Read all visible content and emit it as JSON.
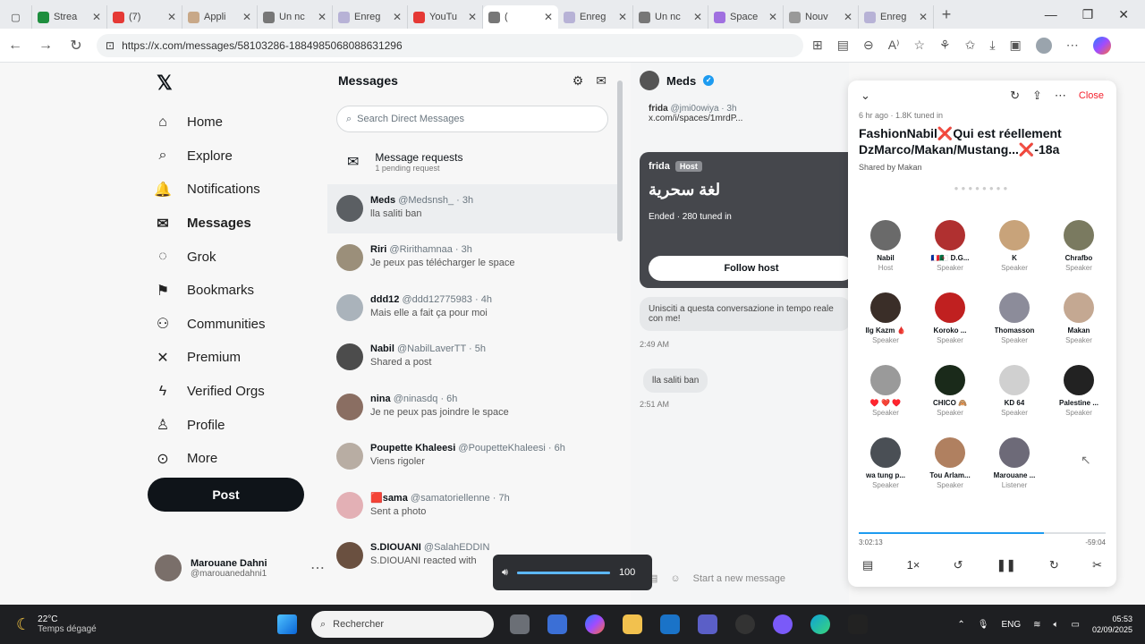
{
  "browser": {
    "tabs": [
      {
        "label": "Strea",
        "color": "#1e8e3e"
      },
      {
        "label": "(7)",
        "color": "#e53935"
      },
      {
        "label": "Appli",
        "color": "#c8a888"
      },
      {
        "label": "Un nc",
        "color": "#777777"
      },
      {
        "label": "Enreg",
        "color": "#b7b2d6"
      },
      {
        "label": "YouTu",
        "color": "#e53935"
      },
      {
        "label": "(",
        "color": "#777777"
      },
      {
        "label": "Enreg",
        "color": "#b7b2d6"
      },
      {
        "label": "Un nc",
        "color": "#777777"
      },
      {
        "label": "Space",
        "color": "#a070e0"
      },
      {
        "label": "Nouv",
        "color": "#999999"
      },
      {
        "label": "Enreg",
        "color": "#b7b2d6"
      }
    ],
    "active_tab_index": 6,
    "url": "https://x.com/messages/58103286-1884985068088631296"
  },
  "sidebar": {
    "items": [
      {
        "label": "Home",
        "icon": "⌂"
      },
      {
        "label": "Explore",
        "icon": "⌕"
      },
      {
        "label": "Notifications",
        "icon": "🔔"
      },
      {
        "label": "Messages",
        "icon": "✉"
      },
      {
        "label": "Grok",
        "icon": "◌"
      },
      {
        "label": "Bookmarks",
        "icon": "⚑"
      },
      {
        "label": "Communities",
        "icon": "⚇"
      },
      {
        "label": "Premium",
        "icon": "✕"
      },
      {
        "label": "Verified Orgs",
        "icon": "ϟ"
      },
      {
        "label": "Profile",
        "icon": "♙"
      },
      {
        "label": "More",
        "icon": "⊙"
      }
    ],
    "post_label": "Post",
    "user_name": "Marouane Dahni",
    "user_handle": "@marouanedahni1"
  },
  "messages": {
    "title": "Messages",
    "search_placeholder": "Search Direct Messages",
    "requests_title": "Message requests",
    "requests_sub": "1 pending request",
    "conversations": [
      {
        "name": "Meds",
        "meta": "@Medsnsh_ · 3h",
        "preview": "lla saliti ban",
        "color": "#5b5f63"
      },
      {
        "name": "Riri",
        "meta": "@Ririthamnaa · 3h",
        "preview": "Je peux pas télécharger le space",
        "color": "#9b8f7a"
      },
      {
        "name": "ddd12",
        "meta": "@ddd12775983 · 4h",
        "preview": "Mais elle a fait ça pour moi",
        "color": "#aab3bb"
      },
      {
        "name": "Nabil",
        "meta": "@NabilLaverTT · 5h",
        "preview": "Shared a post",
        "color": "#4c4c4c"
      },
      {
        "name": "nina",
        "meta": "@ninasdq · 6h",
        "preview": "Je ne peux pas joindre le space",
        "color": "#8a6e62"
      },
      {
        "name": "Poupette Khaleesi",
        "meta": "@PoupetteKhaleesi · 6h",
        "preview": "Viens rigoler",
        "color": "#b8ada3"
      },
      {
        "name": "🟥sama",
        "meta": "@samatoriellenne · 7h",
        "preview": "Sent a photo",
        "color": "#e3b0b5"
      },
      {
        "name": "S.DIOUANI",
        "meta": "@SalahEDDIN",
        "preview": "S.DIOUANI reacted with",
        "color": "#6a5040"
      }
    ]
  },
  "chat": {
    "name": "Meds",
    "quote_name": "frida",
    "quote_handle": "@jmi0owiya · 3h",
    "quote_link": "x.com/i/spaces/1mrdP...",
    "card_host_name": "frida",
    "card_host_badge": "Host",
    "card_title": "لغة سحرية",
    "card_status": "Ended · 280 tuned in",
    "card_follow": "Follow host",
    "bubble1": "Unisciti a questa conversazione in tempo reale con me!",
    "time1": "2:49 AM",
    "bubble2": "lla saliti ban",
    "time2": "2:51 AM",
    "composer_placeholder": "Start a new message"
  },
  "space": {
    "close_label": "Close",
    "meta": "6 hr ago · 1.8K tuned in",
    "title": "FashionNabil❌Qui est réellement DzMarco/Makan/Mustang...❌-18a",
    "shared_by": "Shared by Makan",
    "speakers": [
      {
        "name": "Nabil",
        "role": "Host",
        "color": "#6a6a6a"
      },
      {
        "name": "🇫🇷🇩🇿 D.G...",
        "role": "Speaker",
        "color": "#b03030"
      },
      {
        "name": "K",
        "role": "Speaker",
        "color": "#c8a37a"
      },
      {
        "name": "Chrafbo",
        "role": "Speaker",
        "color": "#7a7a60"
      },
      {
        "name": "Ilg Kazm 🩸",
        "role": "Speaker",
        "color": "#3a2e28"
      },
      {
        "name": "Koroko ...",
        "role": "Speaker",
        "color": "#c02020"
      },
      {
        "name": "Thomasson",
        "role": "Speaker",
        "color": "#8c8c9a"
      },
      {
        "name": "Makan",
        "role": "Speaker",
        "color": "#c4a892"
      },
      {
        "name": "♥️ ❤️ ♥️",
        "role": "Speaker",
        "color": "#9a9a9a"
      },
      {
        "name": "CHICO 🙈",
        "role": "Speaker",
        "color": "#1a2a1a"
      },
      {
        "name": "KD 64",
        "role": "Speaker",
        "color": "#d0d0d0"
      },
      {
        "name": "Palestine ...",
        "role": "Speaker",
        "color": "#222222"
      },
      {
        "name": "wa tung p...",
        "role": "Speaker",
        "color": "#4a4f55"
      },
      {
        "name": "Tou Arlam...",
        "role": "Speaker",
        "color": "#b08060"
      },
      {
        "name": "Marouane ...",
        "role": "Listener",
        "color": "#6d6a78"
      }
    ],
    "time_elapsed": "3:02:13",
    "time_remaining": "-59:04",
    "progress": 0.75,
    "speed": "1×"
  },
  "volume": {
    "level": 100
  },
  "taskbar": {
    "temp": "22°C",
    "weather": "Temps dégagé",
    "search_placeholder": "Rechercher",
    "lang": "ENG",
    "time": "05:53",
    "date": "02/09/2025"
  }
}
